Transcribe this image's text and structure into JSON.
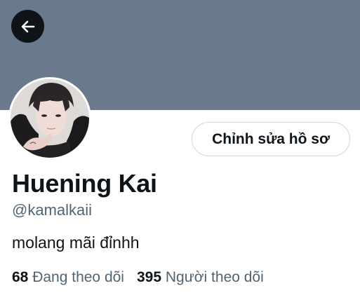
{
  "profile": {
    "display_name": "Huening Kai",
    "handle": "@kamalkaii",
    "bio": "molang mãi đỉnhh",
    "edit_button_label": "Chỉnh sửa hồ sơ",
    "following_count": "68",
    "following_label": "Đang theo dõi",
    "followers_count": "395",
    "followers_label": "Người theo dõi"
  },
  "icons": {
    "back": "arrow-left-icon"
  },
  "colors": {
    "banner": "#6a7a8c",
    "text_primary": "#0f1419",
    "text_secondary": "#536471",
    "button_border": "#cfd9de",
    "back_button_bg": "#0f1419"
  }
}
